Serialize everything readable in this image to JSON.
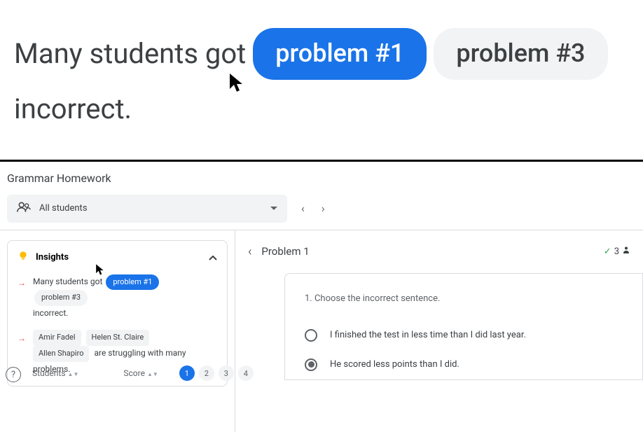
{
  "hero": {
    "prefix": "Many students got",
    "chip_active": "problem #1",
    "chip_inactive": "problem #3",
    "suffix": "incorrect."
  },
  "app": {
    "title": "Grammar Homework",
    "dropdown_label": "All students"
  },
  "insights": {
    "title": "Insights",
    "row1": {
      "prefix": "Many students got",
      "chip_blue": "problem #1",
      "chip_gray": "problem #3",
      "suffix": "incorrect."
    },
    "row2": {
      "name1": "Amir Fadel",
      "name2": "Helen St. Claire",
      "name3": "Allen Shapiro",
      "suffix": "are struggling with many problems."
    }
  },
  "table": {
    "col_students": "Students",
    "col_score": "Score",
    "pages": [
      "1",
      "2",
      "3",
      "4"
    ]
  },
  "problem": {
    "title": "Problem 1",
    "score_count": "3",
    "question": "1.  Choose the incorrect sentence.",
    "options": [
      "I finished the test in less time than I did last year.",
      "He scored less points than I did."
    ],
    "selected_index": 1
  },
  "help_label": "?"
}
